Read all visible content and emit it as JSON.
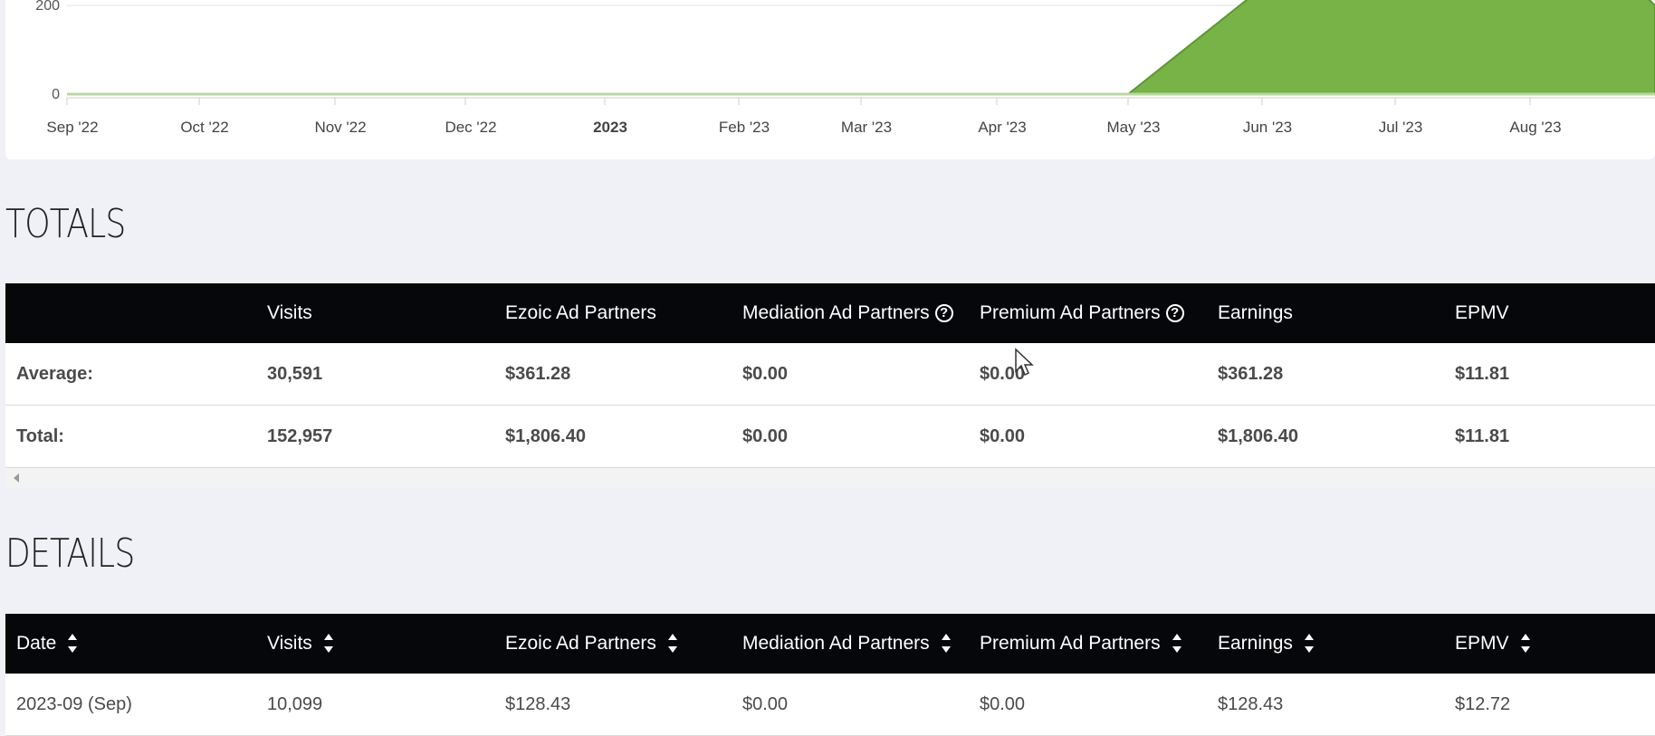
{
  "chart_data": {
    "type": "area",
    "title": "",
    "xlabel": "",
    "ylabel": "",
    "y_ticks": [
      "0",
      "200"
    ],
    "x_ticks": [
      "Sep '22",
      "Oct '22",
      "Nov '22",
      "Dec '22",
      "2023",
      "Feb '23",
      "Mar '23",
      "Apr '23",
      "May '23",
      "Jun '23",
      "Jul '23",
      "Aug '23"
    ],
    "x_tick_bold": [
      false,
      false,
      false,
      false,
      true,
      false,
      false,
      false,
      false,
      false,
      false,
      false
    ],
    "series": [
      {
        "color": "#77b347",
        "points": [
          {
            "x": "Sep '22",
            "y": 0
          },
          {
            "x": "May '23",
            "y": 0
          },
          {
            "x": "Jun '23",
            "y": 240
          },
          {
            "x": "Aug '23",
            "y": 240
          }
        ]
      }
    ],
    "ylim": [
      0,
      200
    ],
    "grid": true
  },
  "totals": {
    "title": "TOTALS",
    "headers": [
      "",
      "Visits",
      "Ezoic Ad Partners",
      "Mediation Ad Partners",
      "Premium Ad Partners",
      "Earnings",
      "EPMV"
    ],
    "help_columns": [
      3,
      4
    ],
    "rows": [
      [
        "Average:",
        "30,591",
        "$361.28",
        "$0.00",
        "$0.00",
        "$361.28",
        "$11.81"
      ],
      [
        "Total:",
        "152,957",
        "$1,806.40",
        "$0.00",
        "$0.00",
        "$1,806.40",
        "$11.81"
      ]
    ]
  },
  "details": {
    "title": "DETAILS",
    "headers": [
      "Date",
      "Visits",
      "Ezoic Ad Partners",
      "Mediation Ad Partners",
      "Premium Ad Partners",
      "Earnings",
      "EPMV"
    ],
    "rows": [
      [
        "2023-09 (Sep)",
        "10,099",
        "$128.43",
        "$0.00",
        "$0.00",
        "$128.43",
        "$12.72"
      ]
    ]
  },
  "colors": {
    "header_bg": "#05070b",
    "chart_fill": "#77b347",
    "page_bg": "#f0f1f6"
  }
}
